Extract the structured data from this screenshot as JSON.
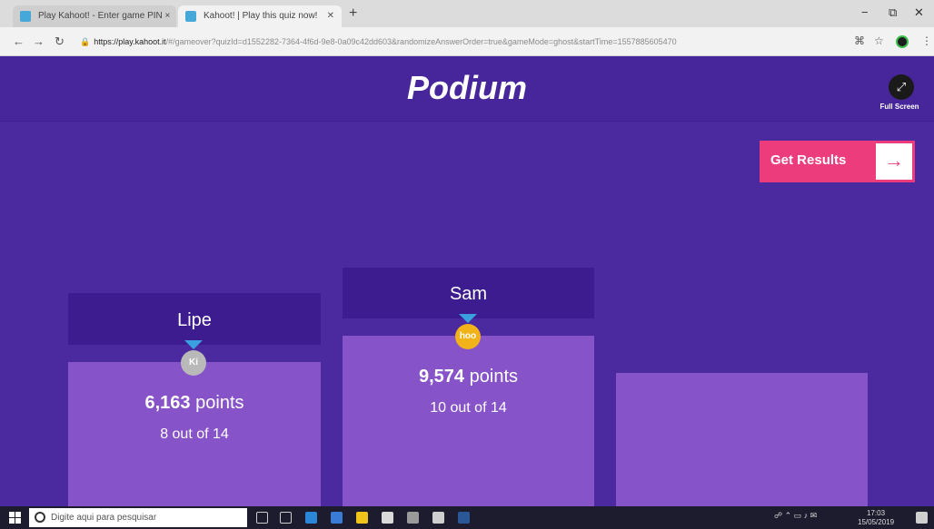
{
  "browser": {
    "tabs": [
      {
        "label": "Play Kahoot! - Enter game PIN ×"
      },
      {
        "label": "Kahoot! | Play this quiz now!"
      }
    ],
    "new_tab_label": "+",
    "url_host": "https://play.kahoot.it",
    "url_rest": "/#/gameover?quizId=d1552282-7364-4f6d-9e8-0a09c42dd603&randomizeAnswerOrder=true&gameMode=ghost&startTime=1557885605470",
    "minimize_label": "−",
    "maximize_label": "⧉",
    "close_label": "✕"
  },
  "header": {
    "title": "Podium",
    "fullscreen_label": "Full Screen",
    "results_label": "Get Results",
    "results_arrow": "→"
  },
  "podium": {
    "second": {
      "name": "Lipe",
      "avatar": "Ki",
      "points_value": "6,163",
      "points_label": "points",
      "correct": "8 out of 14"
    },
    "first": {
      "name": "Sam",
      "avatar": "hoo",
      "points_value": "9,574",
      "points_label": "points",
      "correct": "10 out of 14"
    }
  },
  "taskbar": {
    "search_placeholder": "Digite aqui para pesquisar",
    "time": "17:03",
    "date": "15/05/2019"
  },
  "colors": {
    "background": "#4a2a9e",
    "column": "#8753c8",
    "name_card": "#3c1c8e",
    "results_button": "#ec3c7b",
    "silver_medal": "#b9b9b9",
    "gold_medal": "#f2b21a"
  }
}
